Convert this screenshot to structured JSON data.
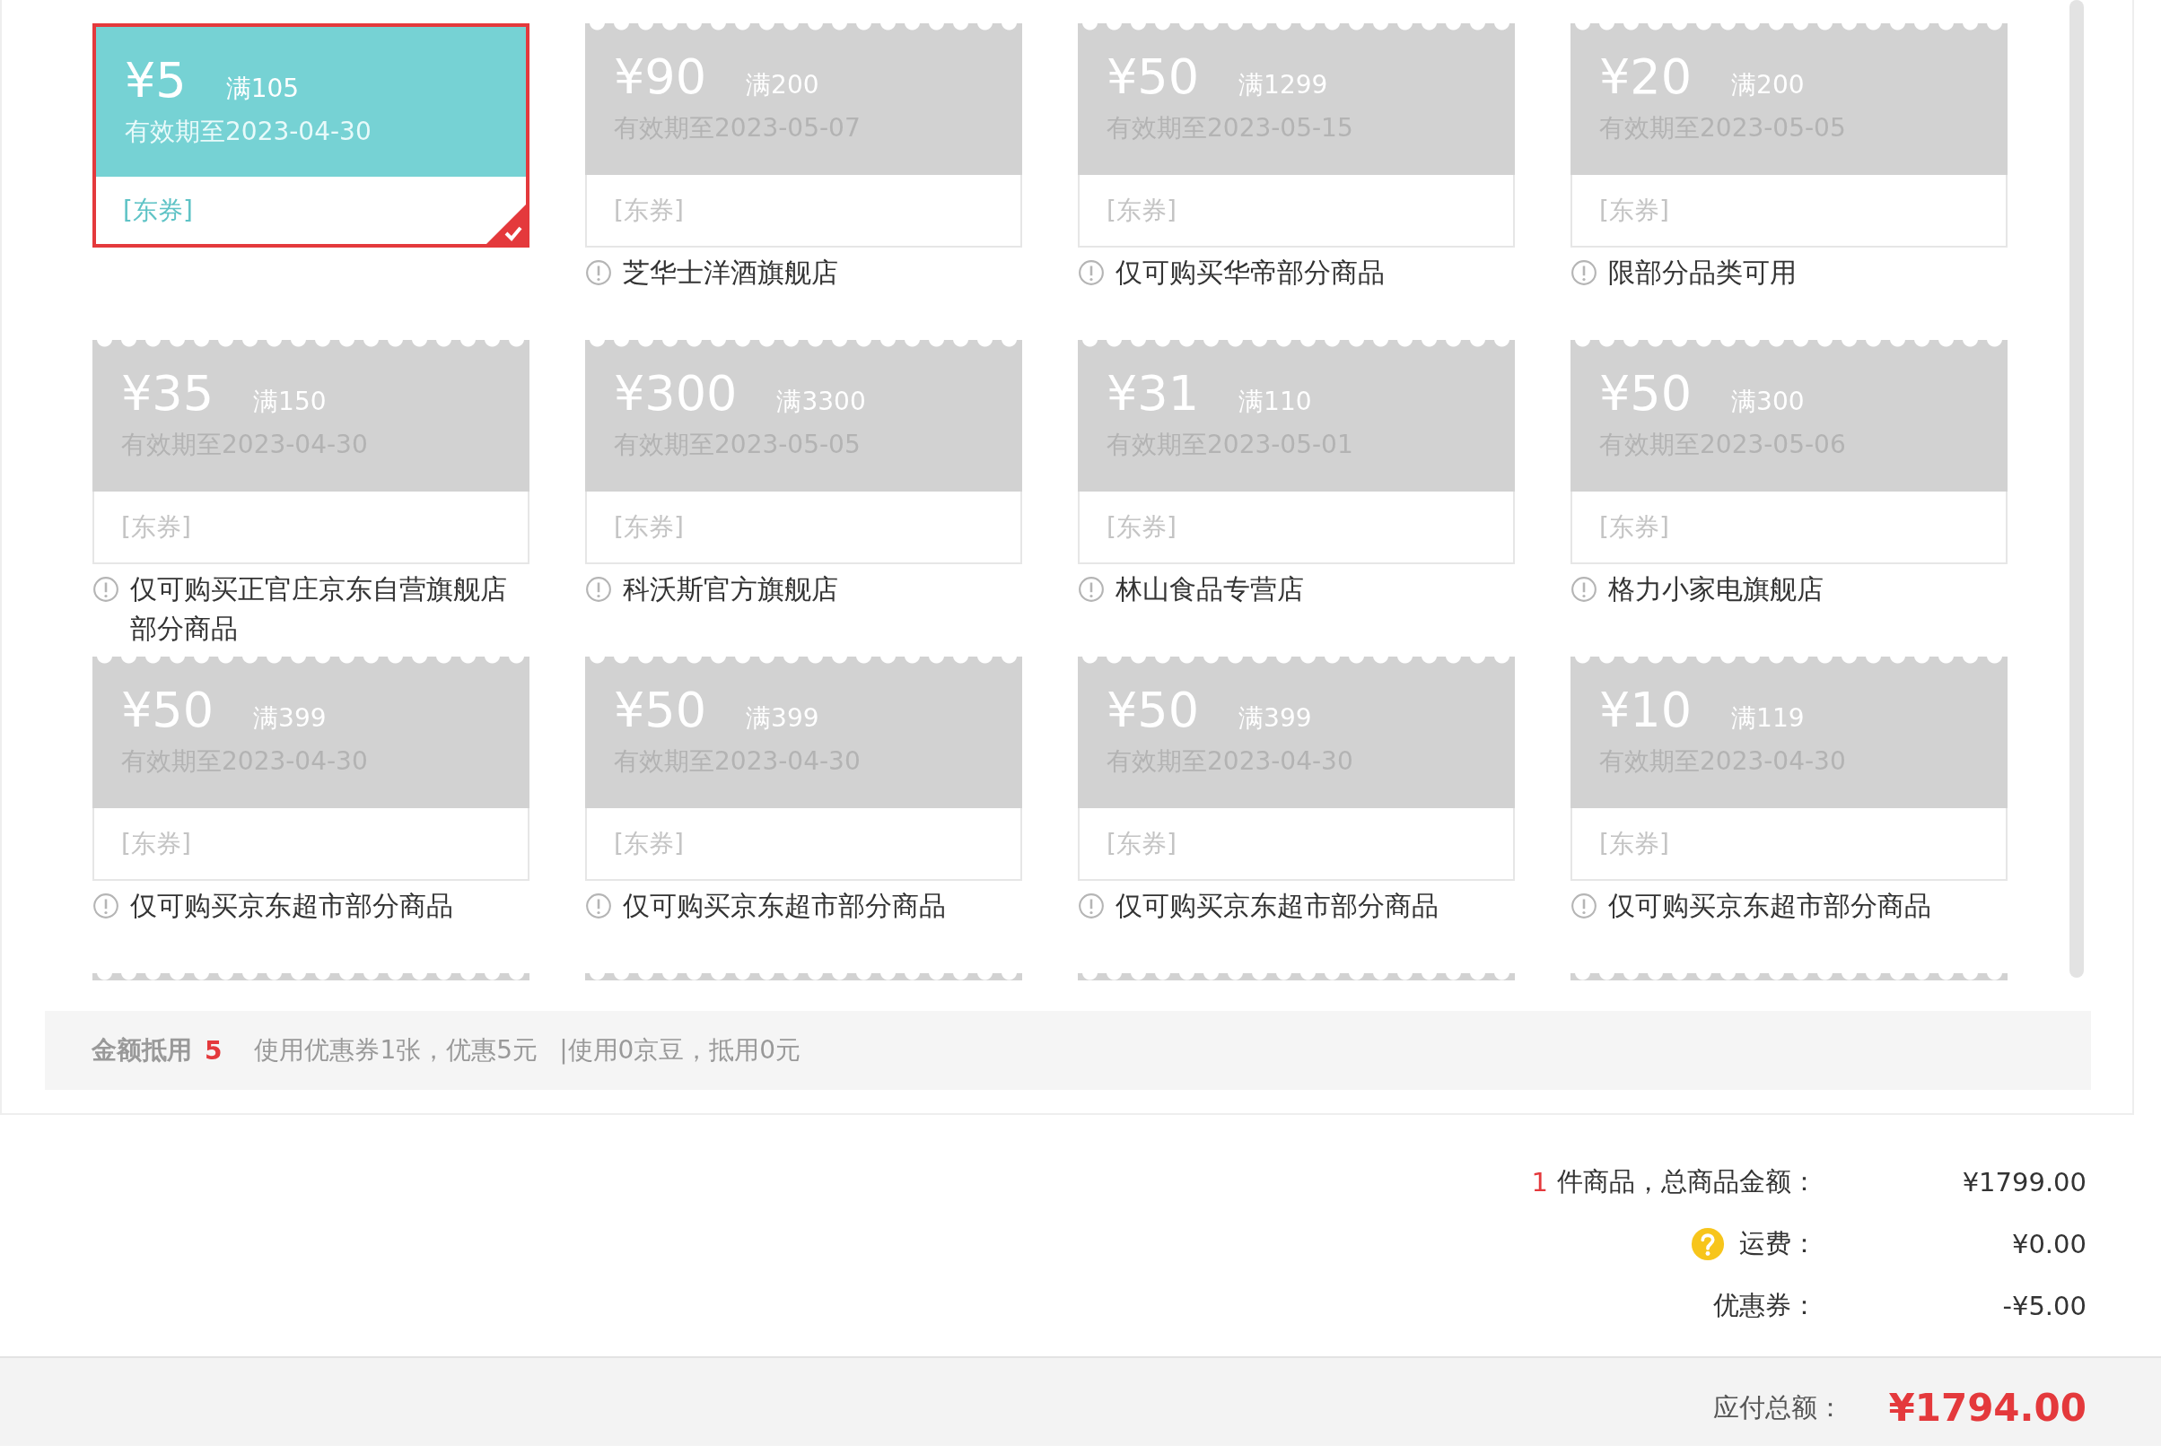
{
  "coupons": [
    {
      "amount": "¥5",
      "threshold": "满105",
      "expiry": "有效期至2023-04-30",
      "tag": "[东券]",
      "selected": true
    },
    {
      "amount": "¥90",
      "threshold": "满200",
      "expiry": "有效期至2023-05-07",
      "tag": "[东券]",
      "note": "芝华士洋酒旗舰店",
      "selected": false
    },
    {
      "amount": "¥50",
      "threshold": "满1299",
      "expiry": "有效期至2023-05-15",
      "tag": "[东券]",
      "note": "仅可购买华帝部分商品",
      "selected": false
    },
    {
      "amount": "¥20",
      "threshold": "满200",
      "expiry": "有效期至2023-05-05",
      "tag": "[东券]",
      "note": "限部分品类可用",
      "selected": false
    },
    {
      "amount": "¥35",
      "threshold": "满150",
      "expiry": "有效期至2023-04-30",
      "tag": "[东券]",
      "note": "仅可购买正官庄京东自营旗舰店部分商品",
      "selected": false
    },
    {
      "amount": "¥300",
      "threshold": "满3300",
      "expiry": "有效期至2023-05-05",
      "tag": "[东券]",
      "note": "科沃斯官方旗舰店",
      "selected": false
    },
    {
      "amount": "¥31",
      "threshold": "满110",
      "expiry": "有效期至2023-05-01",
      "tag": "[东券]",
      "note": "林山食品专营店",
      "selected": false
    },
    {
      "amount": "¥50",
      "threshold": "满300",
      "expiry": "有效期至2023-05-06",
      "tag": "[东券]",
      "note": "格力小家电旗舰店",
      "selected": false
    },
    {
      "amount": "¥50",
      "threshold": "满399",
      "expiry": "有效期至2023-04-30",
      "tag": "[东券]",
      "note": "仅可购买京东超市部分商品",
      "selected": false
    },
    {
      "amount": "¥50",
      "threshold": "满399",
      "expiry": "有效期至2023-04-30",
      "tag": "[东券]",
      "note": "仅可购买京东超市部分商品",
      "selected": false
    },
    {
      "amount": "¥50",
      "threshold": "满399",
      "expiry": "有效期至2023-04-30",
      "tag": "[东券]",
      "note": "仅可购买京东超市部分商品",
      "selected": false
    },
    {
      "amount": "¥10",
      "threshold": "满119",
      "expiry": "有效期至2023-04-30",
      "tag": "[东券]",
      "note": "仅可购买京东超市部分商品",
      "selected": false
    }
  ],
  "deduction": {
    "label": "金额抵用",
    "amount": "5",
    "coupon_text": "使用优惠券1张，优惠5元",
    "beans_text": "|使用0京豆，抵用0元"
  },
  "summary": [
    {
      "kind": "count",
      "count": "1",
      "label": "件商品，总商品金额：",
      "value": "¥1799.00"
    },
    {
      "kind": "help",
      "label": "运费：",
      "value": "¥0.00"
    },
    {
      "kind": "plain",
      "label": "优惠券：",
      "value": "-¥5.00"
    }
  ],
  "total": {
    "label": "应付总额：",
    "value": "¥1794.00"
  }
}
